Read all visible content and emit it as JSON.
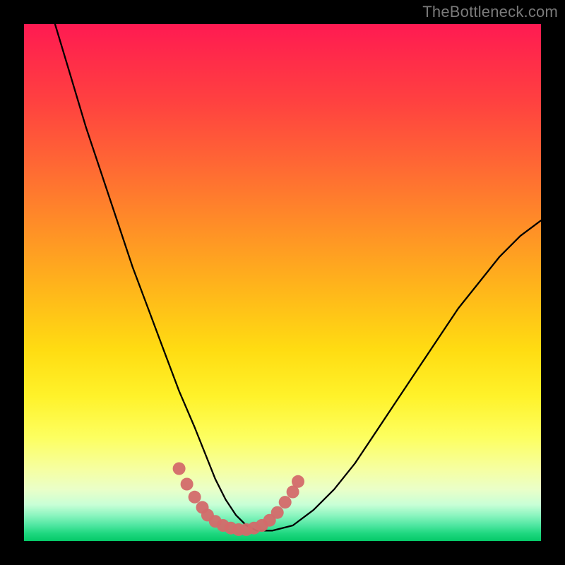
{
  "watermark": "TheBottleneck.com",
  "chart_data": {
    "type": "line",
    "title": "",
    "xlabel": "",
    "ylabel": "",
    "xlim": [
      0,
      100
    ],
    "ylim": [
      0,
      100
    ],
    "grid": false,
    "series": [
      {
        "name": "bottleneck-curve",
        "x": [
          6,
          9,
          12,
          15,
          18,
          21,
          24,
          27,
          30,
          33,
          35,
          37,
          39,
          41,
          43,
          45,
          48,
          52,
          56,
          60,
          64,
          68,
          72,
          76,
          80,
          84,
          88,
          92,
          96,
          100
        ],
        "y": [
          100,
          90,
          80,
          71,
          62,
          53,
          45,
          37,
          29,
          22,
          17,
          12,
          8,
          5,
          3,
          2,
          2,
          3,
          6,
          10,
          15,
          21,
          27,
          33,
          39,
          45,
          50,
          55,
          59,
          62
        ]
      }
    ],
    "highlight_points": {
      "name": "marker-cluster",
      "color": "#d36a6a",
      "x": [
        30,
        31.5,
        33,
        34.5,
        35.5,
        37,
        38.5,
        40,
        41.5,
        43,
        44.5,
        46,
        47.5,
        49,
        50.5,
        52,
        53
      ],
      "y": [
        14,
        11,
        8.5,
        6.5,
        5,
        3.8,
        3,
        2.5,
        2.2,
        2.2,
        2.5,
        3,
        4,
        5.5,
        7.5,
        9.5,
        11.5
      ]
    },
    "background_gradient": {
      "top": "#ff1a52",
      "mid": "#fff22a",
      "bottom": "#05c968"
    }
  }
}
